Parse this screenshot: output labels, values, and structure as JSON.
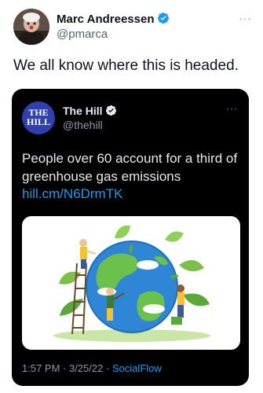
{
  "author": {
    "name": "Marc Andreessen",
    "handle": "@pmarca",
    "avatar_icon": "profile-photo",
    "verified_icon": "verified-badge-icon"
  },
  "tweet": {
    "text": "We all know where this is headed."
  },
  "more_label": "···",
  "quoted": {
    "avatar_text_line1": "THE",
    "avatar_text_line2": "HILL",
    "name": "The Hill",
    "handle": "@thehill",
    "more_label": "···",
    "text": "People over 60 account for a third of greenhouse gas emissions",
    "link": "hill.cm/N6DrmTK",
    "image_icon": "earth-illustration-with-people-planting",
    "timestamp": "1:57 PM · 3/25/22 · ",
    "source": "SocialFlow"
  },
  "colors": {
    "link": "#1d9bf0",
    "verified": "#1d9bf0",
    "card_bg": "#000000",
    "hill_blue": "#2f3fae"
  }
}
